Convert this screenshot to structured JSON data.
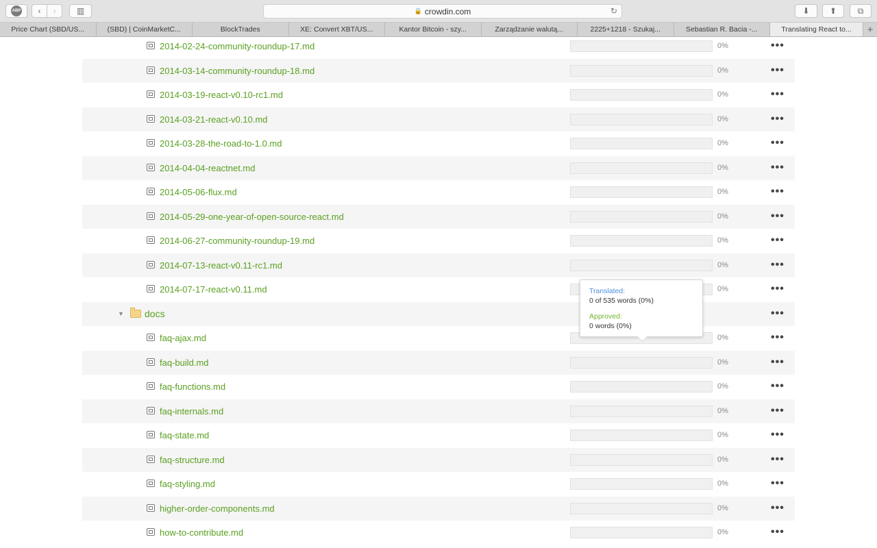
{
  "browser": {
    "url": "crowdin.com",
    "tabs": [
      {
        "label": "Price Chart (SBD/US..."
      },
      {
        "label": "(SBD) | CoinMarketC..."
      },
      {
        "label": "BlockTrades"
      },
      {
        "label": "XE: Convert XBT/US..."
      },
      {
        "label": "Kantor Bitcoin - szy..."
      },
      {
        "label": "Zarządzanie walutą..."
      },
      {
        "label": "2225+1218 - Szukaj..."
      },
      {
        "label": "Sebastian R. Bacia -..."
      },
      {
        "label": "Translating React to..."
      }
    ],
    "new_tab_label": "+"
  },
  "files_top": [
    {
      "name": "2014-02-24-community-roundup-17.md",
      "percent": "0%",
      "progress": 0
    },
    {
      "name": "2014-03-14-community-roundup-18.md",
      "percent": "0%",
      "progress": 0
    },
    {
      "name": "2014-03-19-react-v0.10-rc1.md",
      "percent": "0%",
      "progress": 0
    },
    {
      "name": "2014-03-21-react-v0.10.md",
      "percent": "0%",
      "progress": 0
    },
    {
      "name": "2014-03-28-the-road-to-1.0.md",
      "percent": "0%",
      "progress": 0
    },
    {
      "name": "2014-04-04-reactnet.md",
      "percent": "0%",
      "progress": 0
    },
    {
      "name": "2014-05-06-flux.md",
      "percent": "0%",
      "progress": 0
    },
    {
      "name": "2014-05-29-one-year-of-open-source-react.md",
      "percent": "0%",
      "progress": 0
    },
    {
      "name": "2014-06-27-community-roundup-19.md",
      "percent": "0%",
      "progress": 0
    },
    {
      "name": "2014-07-13-react-v0.11-rc1.md",
      "percent": "0%",
      "progress": 0
    },
    {
      "name": "2014-07-17-react-v0.11.md",
      "percent": "0%",
      "progress": 0
    }
  ],
  "folder": {
    "name": "docs"
  },
  "files_docs": [
    {
      "name": "faq-ajax.md",
      "percent": "0%",
      "progress": 0
    },
    {
      "name": "faq-build.md",
      "percent": "0%",
      "progress": 0
    },
    {
      "name": "faq-functions.md",
      "percent": "0%",
      "progress": 0
    },
    {
      "name": "faq-internals.md",
      "percent": "0%",
      "progress": 0
    },
    {
      "name": "faq-state.md",
      "percent": "0%",
      "progress": 0
    },
    {
      "name": "faq-structure.md",
      "percent": "0%",
      "progress": 0
    },
    {
      "name": "faq-styling.md",
      "percent": "0%",
      "progress": 0
    },
    {
      "name": "higher-order-components.md",
      "percent": "0%",
      "progress": 0
    },
    {
      "name": "how-to-contribute.md",
      "percent": "0%",
      "progress": 0
    }
  ],
  "menu_label": "•••",
  "tooltip": {
    "translated_label": "Translated:",
    "translated_value": "0 of 535 words (0%)",
    "approved_label": "Approved:",
    "approved_value": "0 words (0%)"
  },
  "colors": {
    "link_green": "#5aa021",
    "translated_blue": "#4a90d9",
    "approved_green": "#6fb52c"
  }
}
